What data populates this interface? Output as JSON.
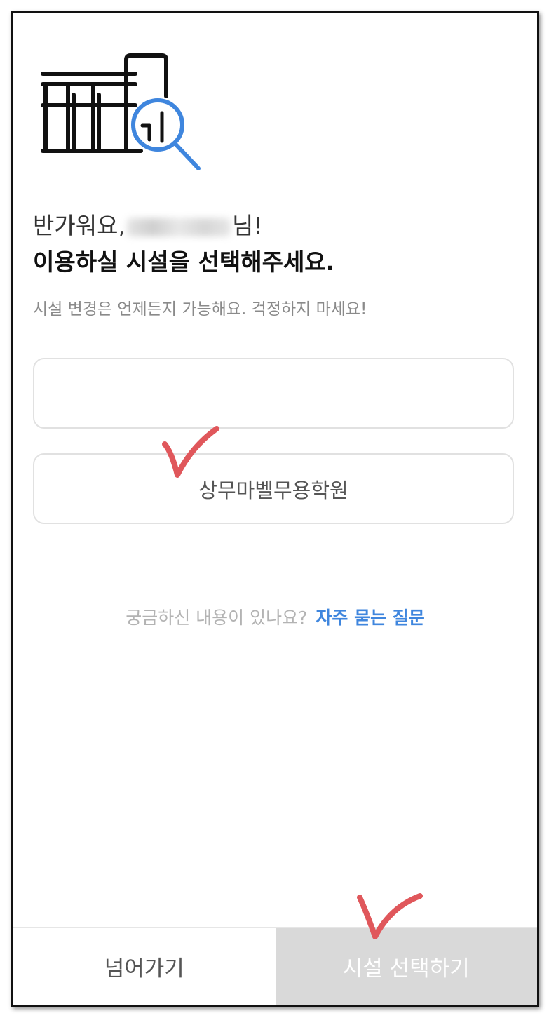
{
  "greeting": {
    "prefix": "반가워요,",
    "suffix": "님!"
  },
  "headline": "이용하실 시설을 선택해주세요.",
  "subtext": "시설 변경은 언제든지 가능해요. 걱정하지 마세요!",
  "options": [
    {
      "label": ""
    },
    {
      "label": "상무마벨무용학원"
    }
  ],
  "faq": {
    "question": "궁금하신 내용이 있나요?",
    "link_label": "자주 묻는 질문"
  },
  "buttons": {
    "skip_label": "넘어가기",
    "select_label": "시설 선택하기"
  },
  "colors": {
    "accent": "#3f86de",
    "check_mark": "#e0575b",
    "select_button_bg": "#d9d9d9"
  },
  "icons": {
    "illustration": "building-search-icon"
  }
}
